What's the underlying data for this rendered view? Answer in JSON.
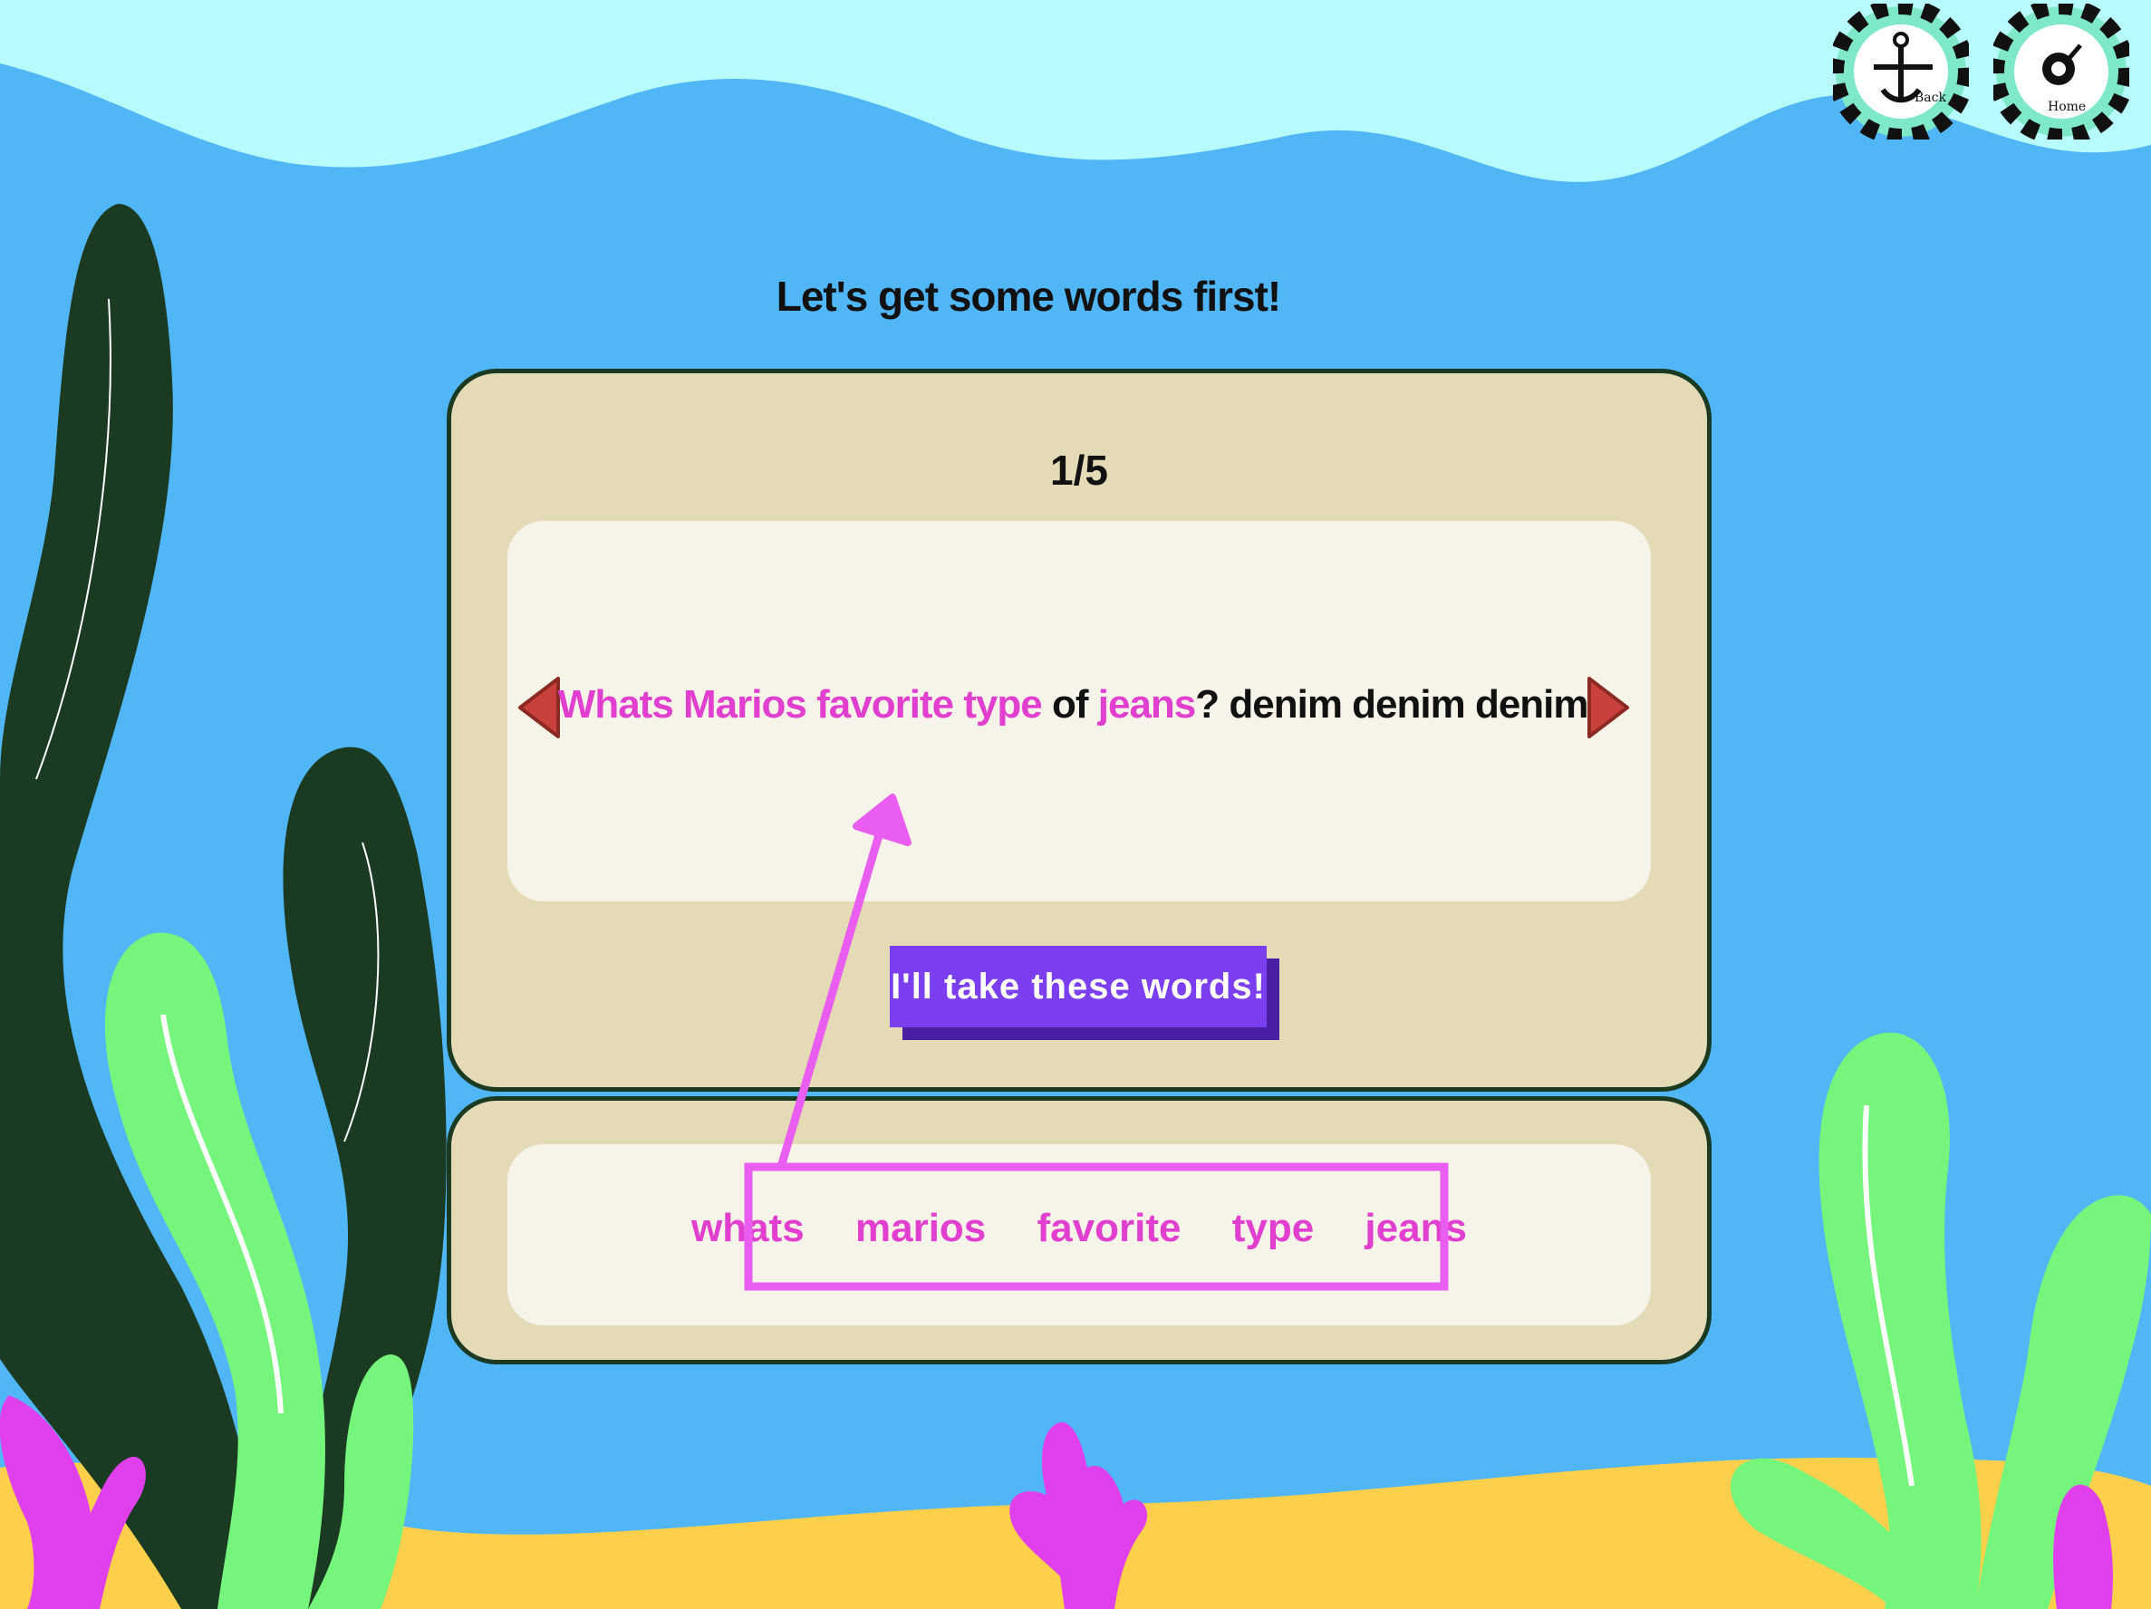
{
  "header": {
    "title": "Let's get some words first!"
  },
  "nav": {
    "back_label": "Back",
    "home_label": "Home"
  },
  "card": {
    "counter": "1/5",
    "sentence": [
      {
        "text": "Whats",
        "key": true
      },
      {
        "text": " ",
        "key": false
      },
      {
        "text": "Marios",
        "key": true
      },
      {
        "text": " ",
        "key": false
      },
      {
        "text": "favorite",
        "key": true
      },
      {
        "text": " ",
        "key": false
      },
      {
        "text": "type",
        "key": true
      },
      {
        "text": " of ",
        "key": false
      },
      {
        "text": "jeans",
        "key": true
      },
      {
        "text": "? denim denim denim!",
        "key": false
      }
    ],
    "take_button_label": "I'll take these words!"
  },
  "word_bank": {
    "words": [
      "whats",
      "marios",
      "favorite",
      "type",
      "jeans"
    ]
  },
  "colors": {
    "highlight": "#e03fcf",
    "button": "#7b3ff0",
    "ocean": "#51b6f6",
    "sand": "#fcd04a"
  }
}
